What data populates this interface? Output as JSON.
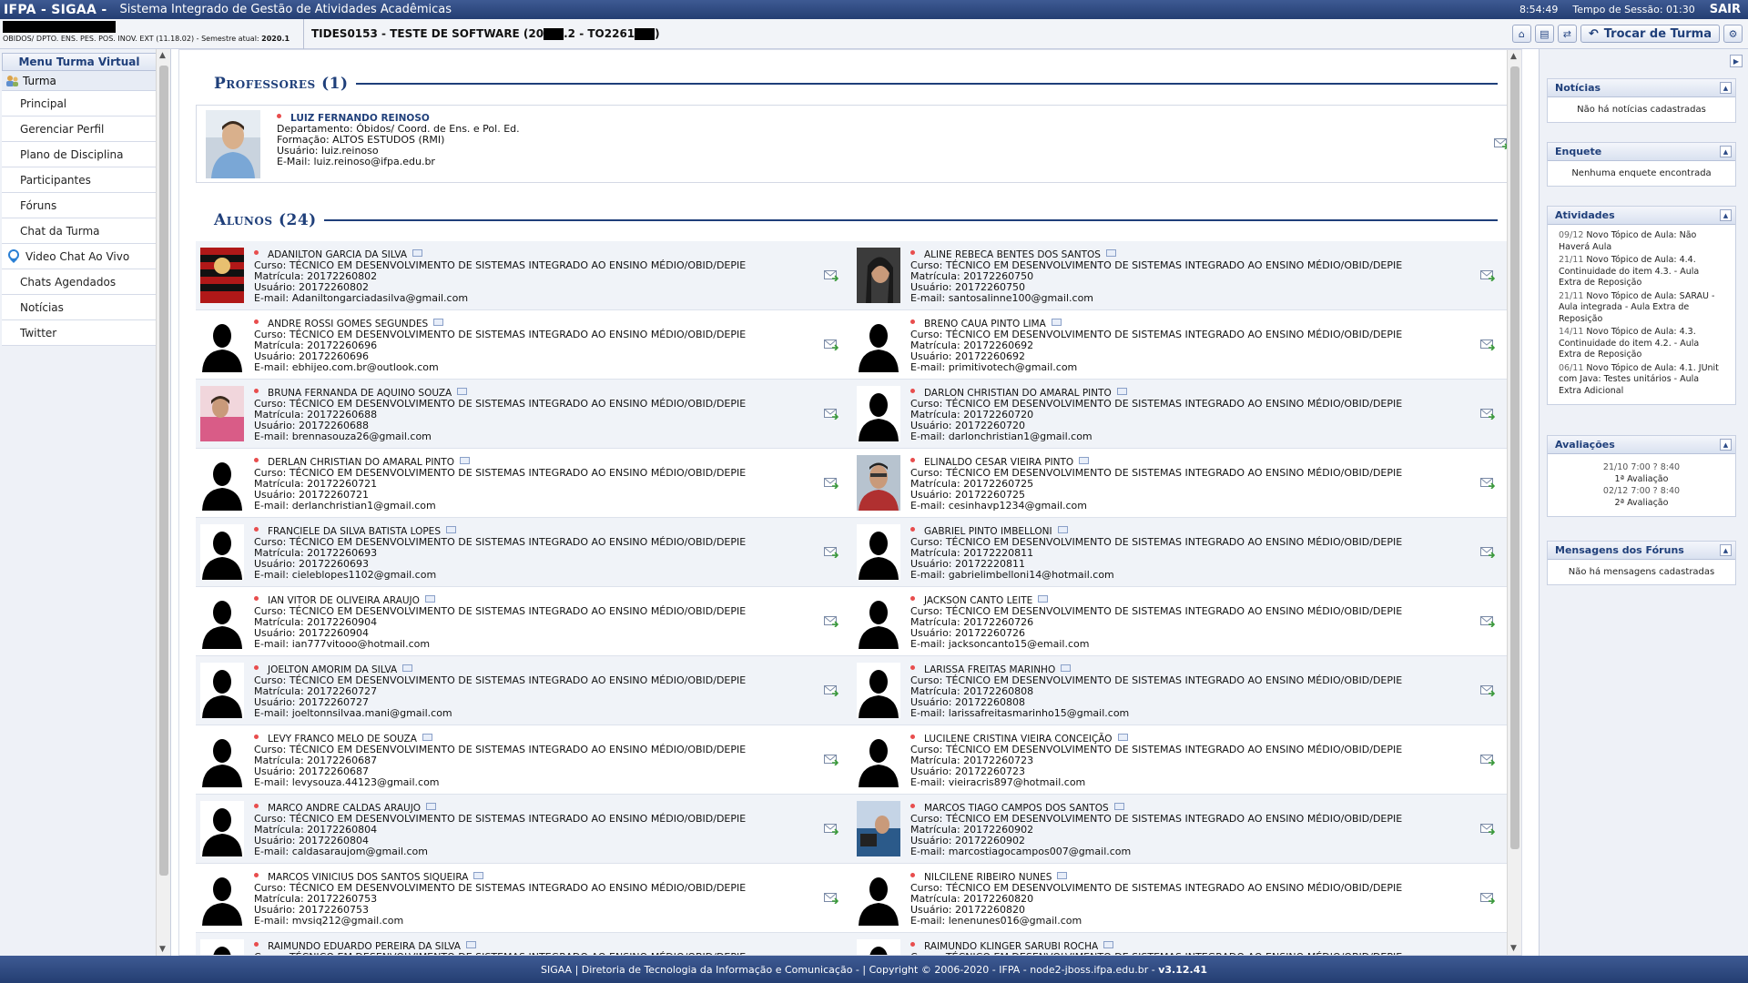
{
  "topbar": {
    "brand": "IFPA - SIGAA -",
    "system_name": "Sistema Integrado de Gestão de Atividades Acadêmicas",
    "clock": "8:54:49",
    "session": "Tempo de Sessão: 01:30",
    "logout": "SAIR"
  },
  "infobar": {
    "unit": "OBIDOS/ DPTO. ENS. PES. POS. INOV. EXT (11.18.02)",
    "semester_label": "- Semestre atual:",
    "semester": "2020.1",
    "turma_a": "TIDES0153 - TESTE DE SOFTWARE (20",
    "turma_b": ".2 - TO2261",
    "turma_c": ")",
    "switch_turma": "Trocar de Turma"
  },
  "menu": {
    "title": "Menu Turma Virtual",
    "group": "Turma",
    "items": [
      "Principal",
      "Gerenciar Perfil",
      "Plano de Disciplina",
      "Participantes",
      "Fóruns",
      "Chat da Turma"
    ],
    "video": "Video Chat Ao Vivo",
    "items2": [
      "Chats Agendados",
      "Notícias",
      "Twitter"
    ]
  },
  "professors": {
    "title": "Professores (1)",
    "list": [
      {
        "name": "LUIZ FERNANDO REINOSO",
        "dept": "Departamento: Óbidos/ Coord. de Ens. e Pol. Ed.",
        "formacao": "Formação: ALTOS ESTUDOS (RMI)",
        "usuario": "Usuário: luiz.reinoso",
        "email": "E-Mail: luiz.reinoso@ifpa.edu.br"
      }
    ]
  },
  "students": {
    "title": "Alunos (24)",
    "course": "Curso: TÉCNICO EM DESENVOLVIMENTO DE SISTEMAS INTEGRADO AO ENSINO MÉDIO/OBID/DEPIE",
    "rows": [
      [
        {
          "name": "ADANILTON GARCIA DA SILVA",
          "matricula": "Matrícula: 20172260802",
          "usuario": "Usuário: 20172260802",
          "email": "E-mail: Adaniltongarciadasilva@gmail.com",
          "photo": "flag"
        },
        {
          "name": "ALINE REBECA BENTES DOS SANTOS",
          "matricula": "Matrícula: 20172260750",
          "usuario": "Usuário: 20172260750",
          "email": "E-mail: santosalinne100@gmail.com",
          "photo": "woman"
        }
      ],
      [
        {
          "name": "ANDRE ROSSI GOMES SEGUNDES",
          "matricula": "Matrícula: 20172260696",
          "usuario": "Usuário: 20172260696",
          "email": "E-mail: ebhijeo.com.br@outlook.com",
          "photo": "silhouette"
        },
        {
          "name": "BRENO CAUA PINTO LIMA",
          "matricula": "Matrícula: 20172260692",
          "usuario": "Usuário: 20172260692",
          "email": "E-mail: primitivotech@gmail.com",
          "photo": "silhouette"
        }
      ],
      [
        {
          "name": "BRUNA FERNANDA DE AQUINO SOUZA",
          "matricula": "Matrícula: 20172260688",
          "usuario": "Usuário: 20172260688",
          "email": "E-mail: brennasouza26@gmail.com",
          "photo": "pink"
        },
        {
          "name": "DARLON CHRISTIAN DO AMARAL PINTO",
          "matricula": "Matrícula: 20172260720",
          "usuario": "Usuário: 20172260720",
          "email": "E-mail: darlonchristian1@gmail.com",
          "photo": "silhouette"
        }
      ],
      [
        {
          "name": "DERLAN CHRISTIAN DO AMARAL PINTO",
          "matricula": "Matrícula: 20172260721",
          "usuario": "Usuário: 20172260721",
          "email": "E-mail: derlanchristian1@gmail.com",
          "photo": "silhouette"
        },
        {
          "name": "ELINALDO CESAR VIEIRA PINTO",
          "matricula": "Matrícula: 20172260725",
          "usuario": "Usuário: 20172260725",
          "email": "E-mail: cesinhavp1234@gmail.com",
          "photo": "man"
        }
      ],
      [
        {
          "name": "FRANCIELE DA SILVA BATISTA LOPES",
          "matricula": "Matrícula: 20172260693",
          "usuario": "Usuário: 20172260693",
          "email": "E-mail: cieleblopes1102@gmail.com",
          "photo": "silhouette"
        },
        {
          "name": "GABRIEL PINTO IMBELLONI",
          "matricula": "Matrícula: 20172220811",
          "usuario": "Usuário: 20172220811",
          "email": "E-mail: gabrielimbelloni14@hotmail.com",
          "photo": "silhouette"
        }
      ],
      [
        {
          "name": "IAN VITOR DE OLIVEIRA ARAUJO",
          "matricula": "Matrícula: 20172260904",
          "usuario": "Usuário: 20172260904",
          "email": "E-mail: ian777vitooo@hotmail.com",
          "photo": "silhouette"
        },
        {
          "name": "JACKSON CANTO LEITE",
          "matricula": "Matrícula: 20172260726",
          "usuario": "Usuário: 20172260726",
          "email": "E-mail: jacksoncanto15@email.com",
          "photo": "silhouette"
        }
      ],
      [
        {
          "name": "JOELTON AMORIM DA SILVA",
          "matricula": "Matrícula: 20172260727",
          "usuario": "Usuário: 20172260727",
          "email": "E-mail: joeltonnsilvaa.mani@gmail.com",
          "photo": "silhouette"
        },
        {
          "name": "LARISSA FREITAS MARINHO",
          "matricula": "Matrícula: 20172260808",
          "usuario": "Usuário: 20172260808",
          "email": "E-mail: larissafreitasmarinho15@gmail.com",
          "photo": "silhouette"
        }
      ],
      [
        {
          "name": "LEVY FRANCO MELO DE SOUZA",
          "matricula": "Matrícula: 20172260687",
          "usuario": "Usuário: 20172260687",
          "email": "E-mail: levysouza.44123@gmail.com",
          "photo": "silhouette"
        },
        {
          "name": "LUCILENE CRISTINA VIEIRA CONCEIÇÃO",
          "matricula": "Matrícula: 20172260723",
          "usuario": "Usuário: 20172260723",
          "email": "E-mail: vieiracris897@hotmail.com",
          "photo": "silhouette"
        }
      ],
      [
        {
          "name": "MARCO ANDRE CALDAS ARAUJO",
          "matricula": "Matrícula: 20172260804",
          "usuario": "Usuário: 20172260804",
          "email": "E-mail: caldasaraujom@gmail.com",
          "photo": "silhouette"
        },
        {
          "name": "MARCOS TIAGO CAMPOS DOS SANTOS",
          "matricula": "Matrícula: 20172260902",
          "usuario": "Usuário: 20172260902",
          "email": "E-mail: marcostiagocampos007@gmail.com",
          "photo": "blue"
        }
      ],
      [
        {
          "name": "MARCOS VINICIUS DOS SANTOS SIQUEIRA",
          "matricula": "Matrícula: 20172260753",
          "usuario": "Usuário: 20172260753",
          "email": "E-mail: mvsiq212@gmail.com",
          "photo": "silhouette"
        },
        {
          "name": "NILCILENE RIBEIRO NUNES",
          "matricula": "Matrícula: 20172260820",
          "usuario": "Usuário: 20172260820",
          "email": "E-mail: lenenunes016@gmail.com",
          "photo": "silhouette"
        }
      ],
      [
        {
          "name": "RAIMUNDO EDUARDO PEREIRA DA SILVA",
          "matricula": "",
          "usuario": "",
          "email": "",
          "photo": "silhouette"
        },
        {
          "name": "RAIMUNDO KLINGER SARUBI ROCHA",
          "matricula": "",
          "usuario": "",
          "email": "",
          "photo": "silhouette"
        }
      ]
    ]
  },
  "sidebar": {
    "noticias_title": "Notícias",
    "noticias_body": "Não há notícias cadastradas",
    "enquete_title": "Enquete",
    "enquete_body": "Nenhuma enquete encontrada",
    "atividades_title": "Atividades",
    "atividades": [
      {
        "date": "09/12",
        "text": "Novo Tópico de Aula: Não Haverá Aula"
      },
      {
        "date": "21/11",
        "text": "Novo Tópico de Aula: 4.4. Continuidade do item 4.3. - Aula Extra de Reposição"
      },
      {
        "date": "21/11",
        "text": "Novo Tópico de Aula: SARAU - Aula integrada - Aula Extra de Reposição"
      },
      {
        "date": "14/11",
        "text": "Novo Tópico de Aula: 4.3. Continuidade do item 4.2. - Aula Extra de Reposição"
      },
      {
        "date": "06/11",
        "text": "Novo Tópico de Aula: 4.1. JUnit com Java: Testes unitários - Aula Extra Adicional"
      }
    ],
    "avaliacoes_title": "Avaliações",
    "avaliacoes": [
      {
        "date": "21/10 7:00 ? 8:40",
        "name": "1ª Avaliação"
      },
      {
        "date": "02/12 7:00 ? 8:40",
        "name": "2ª Avaliação"
      }
    ],
    "foruns_title": "Mensagens dos Fóruns",
    "foruns_body": "Não há mensagens cadastradas"
  },
  "footer": {
    "text": "SIGAA | Diretoria de Tecnologia da Informação e Comunicação - | Copyright © 2006-2020 - IFPA - node2-jboss.ifpa.edu.br -",
    "version": "v3.12.41"
  },
  "colors": {
    "brand_blue": "#243e72",
    "heading_blue": "#1f3f7a",
    "status_dot": "#e84d4d"
  }
}
